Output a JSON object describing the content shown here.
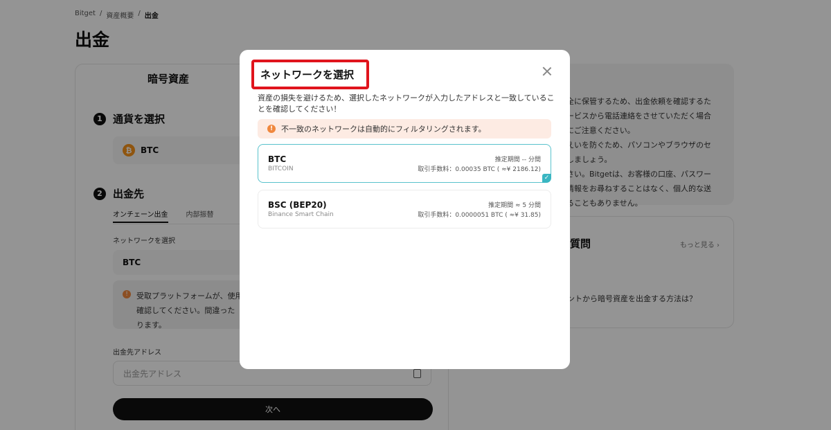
{
  "breadcrumb": {
    "home": "Bitget",
    "assets": "資産概要",
    "current": "出金"
  },
  "page": {
    "title": "出金"
  },
  "left": {
    "tab": "暗号資産",
    "step1": {
      "num": "1",
      "label": "通貨を選択"
    },
    "coin": {
      "symbol": "BTC",
      "icon_glyph": "₿"
    },
    "step2": {
      "num": "2",
      "label": "出金先"
    },
    "subtabs": [
      "オンチェーン出金",
      "内部振替"
    ],
    "network_label": "ネットワークを選択",
    "network_value": "BTC",
    "warning_lines": [
      "受取プラットフォームが、使用",
      "確認してください。間違った",
      "ります。"
    ],
    "address_label": "出金先アドレス",
    "address_placeholder": "出金先アドレス",
    "next_button": "次へ"
  },
  "right": {
    "notice_lines": [
      "全に保管するため、出金依頼を確認するた",
      "ービスから電話連絡をさせていただく場合",
      "にご注意ください。",
      "えいを防ぐため、パソコンやブラウザのセ",
      "しましょう。",
      "さい。Bitgetは、お客様の口座、パスワー",
      "情報をお尋ねすることはなく、個人的な送",
      "ることもありません。"
    ],
    "faq_title": "質問",
    "faq_more": "もっと見る ›",
    "faq_item": "ントから暗号資産を出金する方法は？"
  },
  "modal": {
    "title": "ネットワークを選択",
    "description": "資産の損失を避けるため、選択したネットワークが入力したアドレスと一致していることを確認してください！",
    "notice": "不一致のネットワークは自動的にフィルタリングされます。",
    "networks": [
      {
        "name": "BTC",
        "full_name": "BITCOIN",
        "time": "推定期間 -- 分間",
        "fee": "取引手数料：0.00035 BTC ( ≈¥ 2186.12)",
        "selected": true
      },
      {
        "name": "BSC (BEP20)",
        "full_name": "Binance Smart Chain",
        "time": "推定期間 ≈ 5 分間",
        "fee": "取引手数料：0.0000051 BTC ( ≈¥ 31.85)",
        "selected": false
      }
    ]
  },
  "colors": {
    "highlight_box": "#e0141c",
    "selected_border": "#58c2cc",
    "warning_orange": "#f0883e",
    "notice_bg": "#fdebe3"
  }
}
